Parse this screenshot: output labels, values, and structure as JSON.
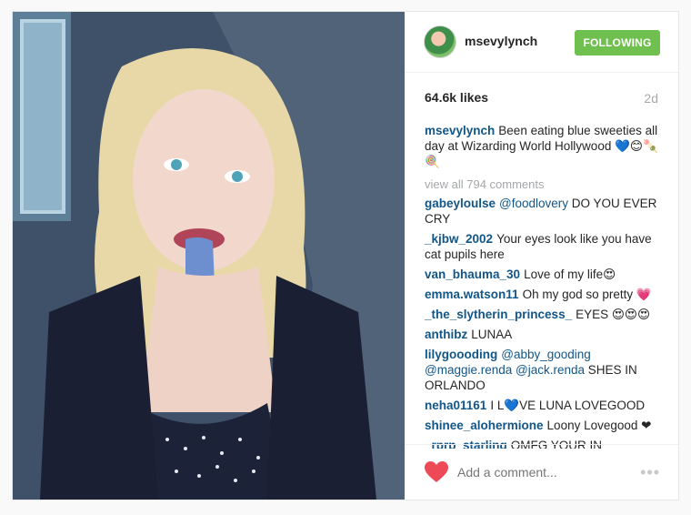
{
  "post": {
    "username": "msevylynch",
    "follow_label": "FOLLOWING",
    "likes": "64.6k likes",
    "time": "2d",
    "caption": "Been eating blue sweeties all day at Wizarding World Hollywood 💙😊🍡 🍭",
    "view_all": "view all 794 comments"
  },
  "comments": [
    {
      "user": "gabeyloulse",
      "mention": "@foodlovery",
      "text": "DO YOU EVER CRY"
    },
    {
      "user": "_kjbw_2002",
      "mention": "",
      "text": "Your eyes look like you have cat pupils here"
    },
    {
      "user": "van_bhauma_30",
      "mention": "",
      "text": "Love of my life😍"
    },
    {
      "user": "emma.watson11",
      "mention": "",
      "text": "Oh my god so pretty 💗"
    },
    {
      "user": "_the_slytherin_princess_",
      "mention": "",
      "text": "EYES 😍😍😍"
    },
    {
      "user": "anthibz",
      "mention": "",
      "text": "LUNAA"
    },
    {
      "user": "lilygoooding",
      "mention": "@abby_gooding @maggie.renda @jack.renda",
      "text": "SHES IN ORLANDO"
    },
    {
      "user": "neha01161",
      "mention": "",
      "text": "I L💙VE LUNA LOVEGOOD"
    },
    {
      "user": "shinee_alohermione",
      "mention": "",
      "text": "Loony Lovegood ❤"
    },
    {
      "user": "_rprp_starling",
      "mention": "",
      "text": "OMFG YOUR IN"
    }
  ],
  "footer": {
    "add_comment_placeholder": "Add a comment...",
    "more_label": "•••"
  },
  "colors": {
    "follow_green": "#70c050",
    "username_blue": "#125688",
    "heart_red": "#ed4956"
  },
  "icons": [
    "heart-icon",
    "more-options-icon",
    "avatar"
  ]
}
